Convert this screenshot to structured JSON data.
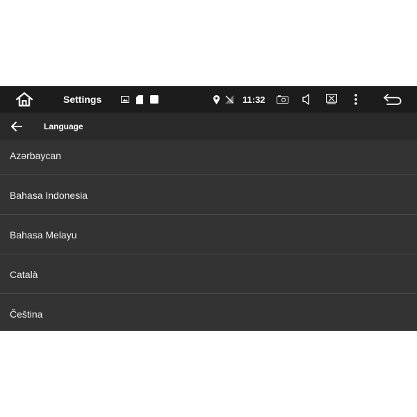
{
  "status_bar": {
    "app_title": "Settings",
    "time": "11:32",
    "icons": [
      "home-icon",
      "image-notification-icon",
      "sd-card-icon",
      "square-notification-icon",
      "location-icon",
      "no-signal-icon",
      "camera-icon",
      "volume-icon",
      "close-window-icon",
      "more-vert-icon",
      "back-icon"
    ]
  },
  "app_bar": {
    "title": "Language"
  },
  "languages": [
    "Azərbaycan",
    "Bahasa Indonesia",
    "Bahasa Melayu",
    "Català",
    "Čeština"
  ],
  "colors": {
    "status_bar_bg": "#1c1c1c",
    "app_bar_bg": "#2a2a2a",
    "list_bg": "#333333",
    "divider": "#4a4a4a",
    "text": "#f2f2f2"
  }
}
